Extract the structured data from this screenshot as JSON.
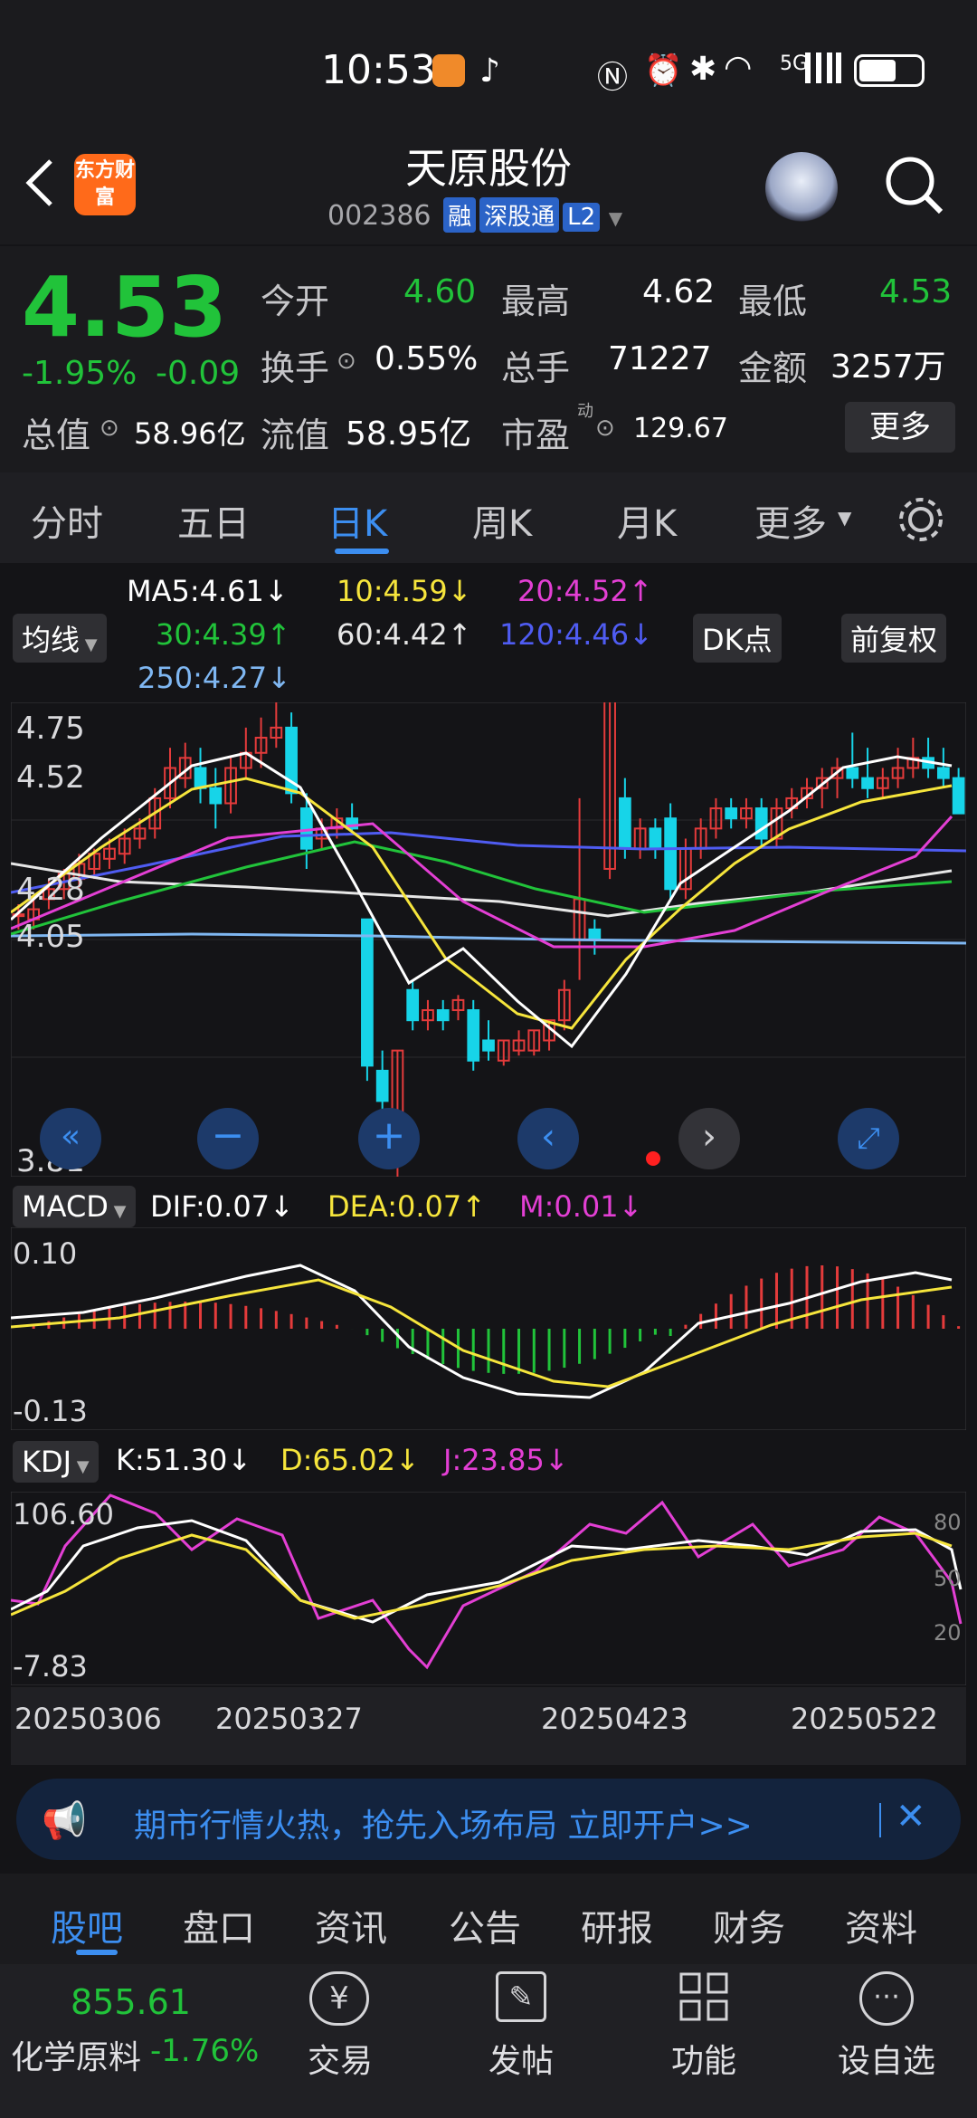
{
  "status_bar": {
    "time": "10:53",
    "network": "5G"
  },
  "header": {
    "app_logo": "东方财富",
    "stock_name": "天原股份",
    "stock_code": "002386",
    "tags": [
      "融",
      "深股通",
      "L2"
    ]
  },
  "quote": {
    "price": "4.53",
    "change_pct": "-1.95%",
    "change_val": "-0.09",
    "today_open_label": "今开",
    "today_open": "4.60",
    "high_label": "最高",
    "high": "4.62",
    "low_label": "最低",
    "low": "4.53",
    "turnover_rate_label": "换手",
    "turnover_rate": "0.55%",
    "volume_label": "总手",
    "volume": "71227",
    "amount_label": "金额",
    "amount": "3257万",
    "mkt_cap_label": "总值",
    "mkt_cap": "58.96亿",
    "float_cap_label": "流值",
    "float_cap": "58.95亿",
    "pe_label": "市盈",
    "pe_sup": "动",
    "pe": "129.67",
    "more_label": "更多"
  },
  "tabs": [
    "分时",
    "五日",
    "日K",
    "周K",
    "月K",
    "更多"
  ],
  "active_tab": "日K",
  "indicators": {
    "ma_button": "均线",
    "ma5": "MA5:4.61↓",
    "ma10": "10:4.59↓",
    "ma20": "20:4.52↑",
    "ma30": "30:4.39↑",
    "ma60": "60:4.42↑",
    "ma120": "120:4.46↓",
    "ma250": "250:4.27↓",
    "dk_button": "DK点",
    "fq_button": "前复权"
  },
  "kline_axis": [
    "4.75",
    "4.52",
    "4.28",
    "4.05",
    "3.81"
  ],
  "macd": {
    "label": "MACD",
    "dif": "DIF:0.07↓",
    "dea": "DEA:0.07↑",
    "m": "M:0.01↓",
    "axis": [
      "0.10",
      "-0.13"
    ]
  },
  "kdj": {
    "label": "KDJ",
    "k": "K:51.30↓",
    "d": "D:65.02↓",
    "j": "J:23.85↓",
    "axis": [
      "106.60",
      "-7.83"
    ],
    "right_axis": [
      "80",
      "50",
      "20"
    ]
  },
  "dates": [
    "20250306",
    "20250327",
    "20250423",
    "20250522"
  ],
  "banner": {
    "text": "期市行情火热，抢先入场布局 立即开户>>"
  },
  "bottom_tabs": [
    "股吧",
    "盘口",
    "资讯",
    "公告",
    "研报",
    "财务",
    "资料"
  ],
  "active_bottom_tab": "股吧",
  "dock": {
    "sector_value": "855.61",
    "sector_name": "化学原料",
    "sector_pct": "-1.76%",
    "items": [
      "交易",
      "发帖",
      "功能",
      "设自选"
    ]
  },
  "colors": {
    "up": "#e43b3b",
    "down": "#17d4e8",
    "green": "#21c33a",
    "accent": "#3c8ef0"
  },
  "chart_data": {
    "type": "candlestick",
    "dates_shown": [
      "20250306",
      "20250327",
      "20250423",
      "20250522"
    ],
    "ylim": [
      3.81,
      4.75
    ],
    "candles": [
      [
        4.33,
        4.35,
        4.3,
        4.33
      ],
      [
        4.32,
        4.36,
        4.3,
        4.34
      ],
      [
        4.36,
        4.4,
        4.34,
        4.38
      ],
      [
        4.38,
        4.42,
        4.36,
        4.41
      ],
      [
        4.4,
        4.45,
        4.38,
        4.43
      ],
      [
        4.42,
        4.46,
        4.4,
        4.45
      ],
      [
        4.44,
        4.48,
        4.42,
        4.46
      ],
      [
        4.45,
        4.5,
        4.43,
        4.48
      ],
      [
        4.48,
        4.52,
        4.46,
        4.5
      ],
      [
        4.5,
        4.58,
        4.48,
        4.56
      ],
      [
        4.56,
        4.66,
        4.54,
        4.62
      ],
      [
        4.6,
        4.67,
        4.58,
        4.64
      ],
      [
        4.62,
        4.66,
        4.55,
        4.58
      ],
      [
        4.58,
        4.62,
        4.5,
        4.55
      ],
      [
        4.55,
        4.64,
        4.53,
        4.62
      ],
      [
        4.62,
        4.7,
        4.6,
        4.65
      ],
      [
        4.65,
        4.72,
        4.62,
        4.68
      ],
      [
        4.68,
        4.76,
        4.66,
        4.7
      ],
      [
        4.7,
        4.73,
        4.55,
        4.57
      ],
      [
        4.54,
        4.57,
        4.42,
        4.46
      ],
      [
        4.48,
        4.52,
        4.46,
        4.5
      ],
      [
        4.5,
        4.54,
        4.48,
        4.52
      ],
      [
        4.52,
        4.55,
        4.49,
        4.5
      ],
      [
        4.32,
        4.32,
        4.0,
        4.03
      ],
      [
        4.02,
        4.06,
        3.9,
        3.96
      ],
      [
        3.93,
        4.06,
        3.81,
        4.06
      ],
      [
        4.18,
        4.2,
        4.1,
        4.12
      ],
      [
        4.12,
        4.16,
        4.1,
        4.14
      ],
      [
        4.14,
        4.16,
        4.1,
        4.12
      ],
      [
        4.14,
        4.17,
        4.12,
        4.16
      ],
      [
        4.14,
        4.16,
        4.02,
        4.04
      ],
      [
        4.08,
        4.12,
        4.04,
        4.06
      ],
      [
        4.04,
        4.08,
        4.03,
        4.08
      ],
      [
        4.06,
        4.1,
        4.05,
        4.08
      ],
      [
        4.06,
        4.1,
        4.05,
        4.1
      ],
      [
        4.08,
        4.12,
        4.06,
        4.12
      ],
      [
        4.12,
        4.2,
        4.1,
        4.18
      ],
      [
        4.28,
        4.56,
        4.2,
        4.36
      ],
      [
        4.3,
        4.32,
        4.25,
        4.28
      ],
      [
        4.42,
        4.78,
        4.4,
        4.78
      ],
      [
        4.56,
        4.6,
        4.44,
        4.46
      ],
      [
        4.46,
        4.52,
        4.44,
        4.5
      ],
      [
        4.5,
        4.52,
        4.44,
        4.46
      ],
      [
        4.52,
        4.55,
        4.36,
        4.38
      ],
      [
        4.38,
        4.48,
        4.36,
        4.46
      ],
      [
        4.46,
        4.52,
        4.44,
        4.5
      ],
      [
        4.5,
        4.56,
        4.48,
        4.54
      ],
      [
        4.54,
        4.56,
        4.5,
        4.52
      ],
      [
        4.52,
        4.56,
        4.5,
        4.54
      ],
      [
        4.54,
        4.56,
        4.46,
        4.48
      ],
      [
        4.48,
        4.56,
        4.46,
        4.54
      ],
      [
        4.54,
        4.58,
        4.52,
        4.56
      ],
      [
        4.56,
        4.6,
        4.54,
        4.58
      ],
      [
        4.58,
        4.62,
        4.54,
        4.6
      ],
      [
        4.6,
        4.64,
        4.56,
        4.62
      ],
      [
        4.62,
        4.69,
        4.58,
        4.6
      ],
      [
        4.6,
        4.66,
        4.56,
        4.58
      ],
      [
        4.58,
        4.62,
        4.56,
        4.6
      ],
      [
        4.6,
        4.66,
        4.58,
        4.62
      ],
      [
        4.62,
        4.68,
        4.6,
        4.64
      ],
      [
        4.64,
        4.68,
        4.6,
        4.62
      ],
      [
        4.62,
        4.66,
        4.58,
        4.6
      ],
      [
        4.6,
        4.62,
        4.53,
        4.53
      ]
    ]
  }
}
